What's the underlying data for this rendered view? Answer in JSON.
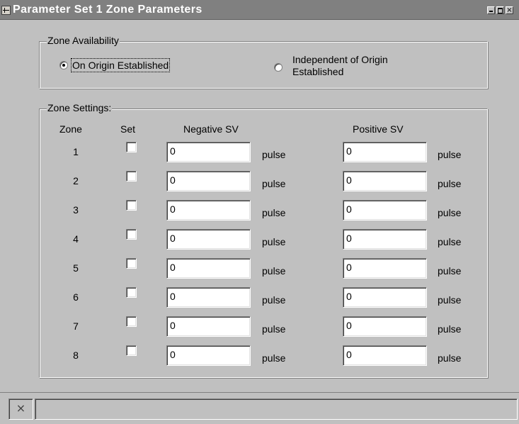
{
  "window": {
    "title": "Parameter Set 1 Zone Parameters",
    "title_icon": "param-set-icon",
    "controls": {
      "minimize": "minimize-icon",
      "maximize": "maximize-icon",
      "close": "×"
    }
  },
  "zone_availability": {
    "label": "Zone Availability",
    "options": [
      {
        "label": "On Origin Established",
        "selected": true
      },
      {
        "label_line1": "Independent of Origin",
        "label_line2": "Established",
        "selected": false
      }
    ]
  },
  "zone_settings": {
    "label": "Zone Settings:",
    "headers": {
      "zone": "Zone",
      "set": "Set",
      "negative": "Negative SV",
      "positive": "Positive SV"
    },
    "rows": [
      {
        "zone": "1",
        "set": false,
        "negative": "0",
        "negative_unit": "pulse",
        "positive": "0",
        "positive_unit": "pulse"
      },
      {
        "zone": "2",
        "set": false,
        "negative": "0",
        "negative_unit": "pulse",
        "positive": "0",
        "positive_unit": "pulse"
      },
      {
        "zone": "3",
        "set": false,
        "negative": "0",
        "negative_unit": "pulse",
        "positive": "0",
        "positive_unit": "pulse"
      },
      {
        "zone": "4",
        "set": false,
        "negative": "0",
        "negative_unit": "pulse",
        "positive": "0",
        "positive_unit": "pulse"
      },
      {
        "zone": "5",
        "set": false,
        "negative": "0",
        "negative_unit": "pulse",
        "positive": "0",
        "positive_unit": "pulse"
      },
      {
        "zone": "6",
        "set": false,
        "negative": "0",
        "negative_unit": "pulse",
        "positive": "0",
        "positive_unit": "pulse"
      },
      {
        "zone": "7",
        "set": false,
        "negative": "0",
        "negative_unit": "pulse",
        "positive": "0",
        "positive_unit": "pulse"
      },
      {
        "zone": "8",
        "set": false,
        "negative": "0",
        "negative_unit": "pulse",
        "positive": "0",
        "positive_unit": "pulse"
      }
    ]
  },
  "statusbar": {
    "button_icon": "close-icon",
    "button_glyph": "×",
    "text": ""
  }
}
